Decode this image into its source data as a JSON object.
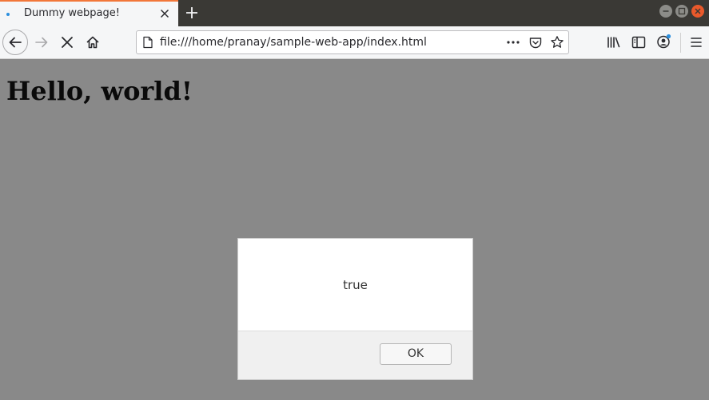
{
  "browser": {
    "tab": {
      "title": "Dummy webpage!",
      "loading": true
    },
    "url": "file:///home/pranay/sample-web-app/index.html",
    "accent_color": "#f27739"
  },
  "page": {
    "heading": "Hello, world!",
    "background": "#898989"
  },
  "dialog": {
    "message": "true",
    "ok_label": "OK"
  }
}
